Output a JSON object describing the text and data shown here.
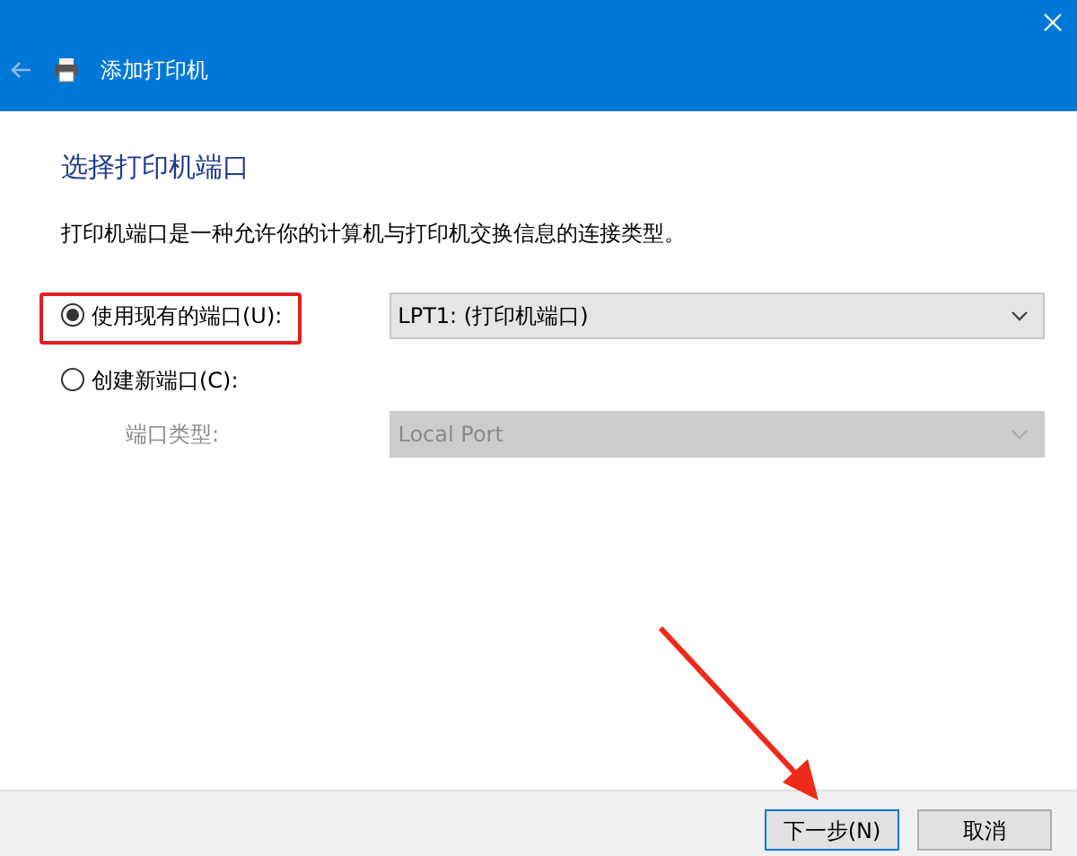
{
  "window": {
    "title": "添加打印机"
  },
  "heading": "选择打印机端口",
  "description": "打印机端口是一种允许你的计算机与打印机交换信息的连接类型。",
  "options": [
    {
      "label": "使用现有的端口(U):",
      "selected": true,
      "dropdown": {
        "value": "LPT1: (打印机端口)",
        "disabled": false
      }
    },
    {
      "label": "创建新端口(C):",
      "selected": false
    }
  ],
  "port_type": {
    "label": "端口类型:",
    "dropdown": {
      "value": "Local Port",
      "disabled": true
    }
  },
  "buttons": [
    "下一步(N)",
    "取消"
  ]
}
